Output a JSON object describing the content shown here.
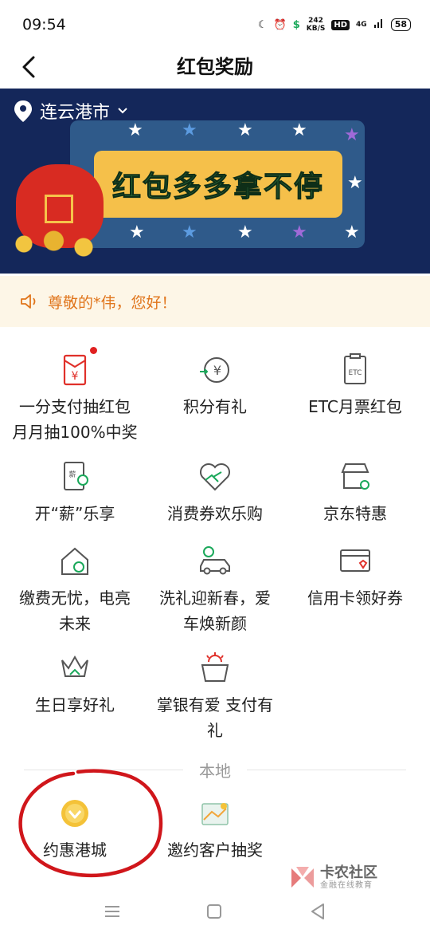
{
  "status_bar": {
    "time": "09:54",
    "net_speed_value": "242",
    "net_speed_unit": "KB/S",
    "hd": "HD",
    "signal": "4G",
    "battery": "58"
  },
  "nav": {
    "title": "红包奖励",
    "back_icon": "chevron-left-icon"
  },
  "banner": {
    "location": "连云港市",
    "slogan": "红包多多拿不停"
  },
  "notice": {
    "text": "尊敬的*伟，您好！",
    "icon": "speaker-icon"
  },
  "grid_items": [
    {
      "label_line1": "一分支付抽红包",
      "label_line2": "月月抽100%中奖",
      "icon": "red-envelope-icon",
      "badge": true
    },
    {
      "label_line1": "积分有礼",
      "label_line2": "",
      "icon": "yuan-exchange-icon"
    },
    {
      "label_line1": "ETC月票红包",
      "label_line2": "",
      "icon": "etc-card-icon"
    },
    {
      "label_line1": "开“薪”乐享",
      "label_line2": "",
      "icon": "salary-document-icon"
    },
    {
      "label_line1": "消费券欢乐购",
      "label_line2": "",
      "icon": "handshake-heart-icon"
    },
    {
      "label_line1": "京东特惠",
      "label_line2": "",
      "icon": "store-icon"
    },
    {
      "label_line1": "缴费无忧，电亮",
      "label_line2": "未来",
      "icon": "house-payment-icon"
    },
    {
      "label_line1": "洗礼迎新春，爱",
      "label_line2": "车焕新颜",
      "icon": "car-wash-icon"
    },
    {
      "label_line1": "信用卡领好券",
      "label_line2": "",
      "icon": "credit-card-icon"
    },
    {
      "label_line1": "生日享好礼",
      "label_line2": "",
      "icon": "crown-gift-icon"
    },
    {
      "label_line1": "掌银有爱 支付有",
      "label_line2": "礼",
      "icon": "basket-icon"
    }
  ],
  "local_section": {
    "title": "本地",
    "items": [
      {
        "label": "约惠港城",
        "icon": "yellow-badge-icon"
      },
      {
        "label": "邀约客户抽奖",
        "icon": "map-ticket-icon"
      }
    ]
  },
  "watermark": {
    "title": "卡农社区",
    "subtitle": "金融在线教育"
  },
  "colors": {
    "accent_red": "#e0302a",
    "notice_orange": "#e0751c",
    "banner_bg": "#14275a",
    "annotation_red": "#d0161b"
  }
}
